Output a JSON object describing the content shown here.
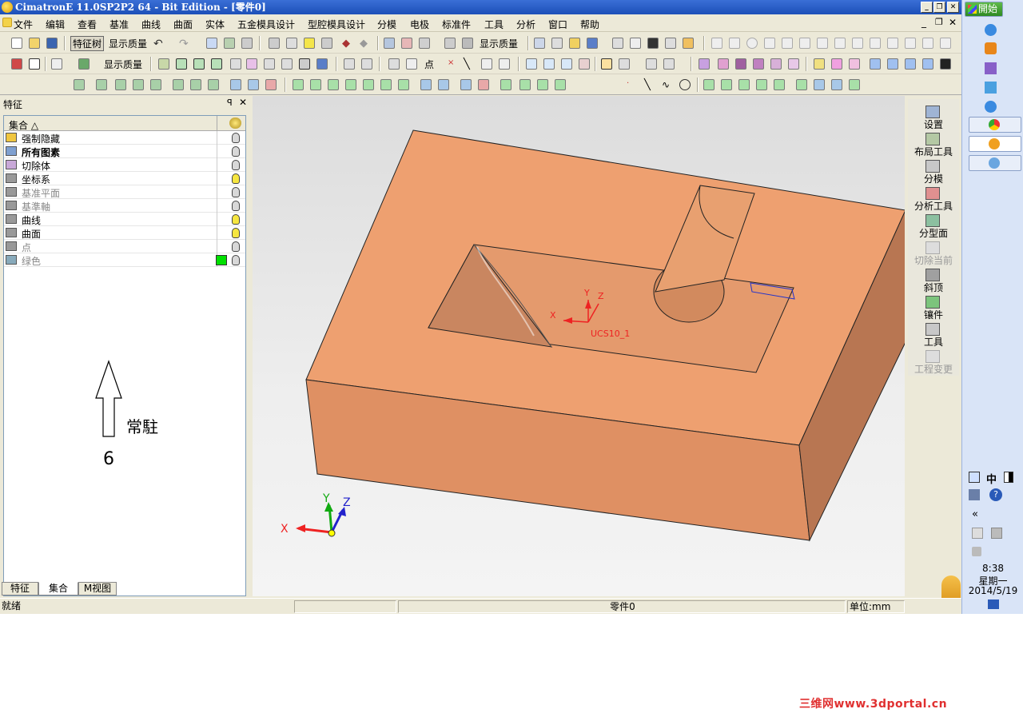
{
  "window": {
    "title": "CimatronE 11.0SP2P2 64 - Bit Edition - [零件0]"
  },
  "menu": [
    "文件",
    "编辑",
    "查看",
    "基准",
    "曲线",
    "曲面",
    "实体",
    "五金模具设计",
    "型腔模具设计",
    "分模",
    "电极",
    "标准件",
    "工具",
    "分析",
    "窗口",
    "帮助"
  ],
  "toolbar": {
    "feature_tree_btn": "特征树",
    "display_quality_1": "显示质量",
    "display_quality_2": "显示质量",
    "display_quality_3": "显示质量",
    "display_quality_4": "显示质量",
    "point_label": "点"
  },
  "panel": {
    "title": "特征",
    "pin": "ꟼ",
    "close": "✕",
    "column_header": "集合 △",
    "rows": [
      {
        "label": "强制隐藏",
        "bold": false,
        "gray": false
      },
      {
        "label": "所有图素",
        "bold": true,
        "gray": false
      },
      {
        "label": "切除体",
        "bold": false,
        "gray": false
      },
      {
        "label": "坐标系",
        "bold": false,
        "gray": false
      },
      {
        "label": "基准平面",
        "bold": false,
        "gray": true
      },
      {
        "label": "基準軸",
        "bold": false,
        "gray": true
      },
      {
        "label": "曲线",
        "bold": false,
        "gray": false
      },
      {
        "label": "曲面",
        "bold": false,
        "gray": false
      },
      {
        "label": "点",
        "bold": false,
        "gray": true
      },
      {
        "label": "绿色",
        "bold": false,
        "gray": true
      }
    ],
    "tabs": [
      "特征",
      "集合",
      "M视图"
    ]
  },
  "annotation": {
    "text": "常駐",
    "number": "6"
  },
  "viewport": {
    "ucs_label": "UCS10_1",
    "ucs_x": "X",
    "ucs_y": "Y",
    "ucs_z": "Z",
    "axis_x": "X",
    "axis_y": "Y",
    "axis_z": "Z",
    "part_color": "#eea070"
  },
  "right_tools": [
    "设置",
    "布局工具",
    "分模",
    "分析工具",
    "分型面",
    "切除当前",
    "斜顶",
    "镶件",
    "工具",
    "工程变更"
  ],
  "status": {
    "left": "就绪",
    "mid": "零件0",
    "right": "单位:mm"
  },
  "taskbar": {
    "start": "開始",
    "ime": "中",
    "time": "8:38",
    "weekday": "星期一",
    "date": "2014/5/19",
    "expand": "«"
  },
  "watermark": "三维网www.3dportal.cn"
}
